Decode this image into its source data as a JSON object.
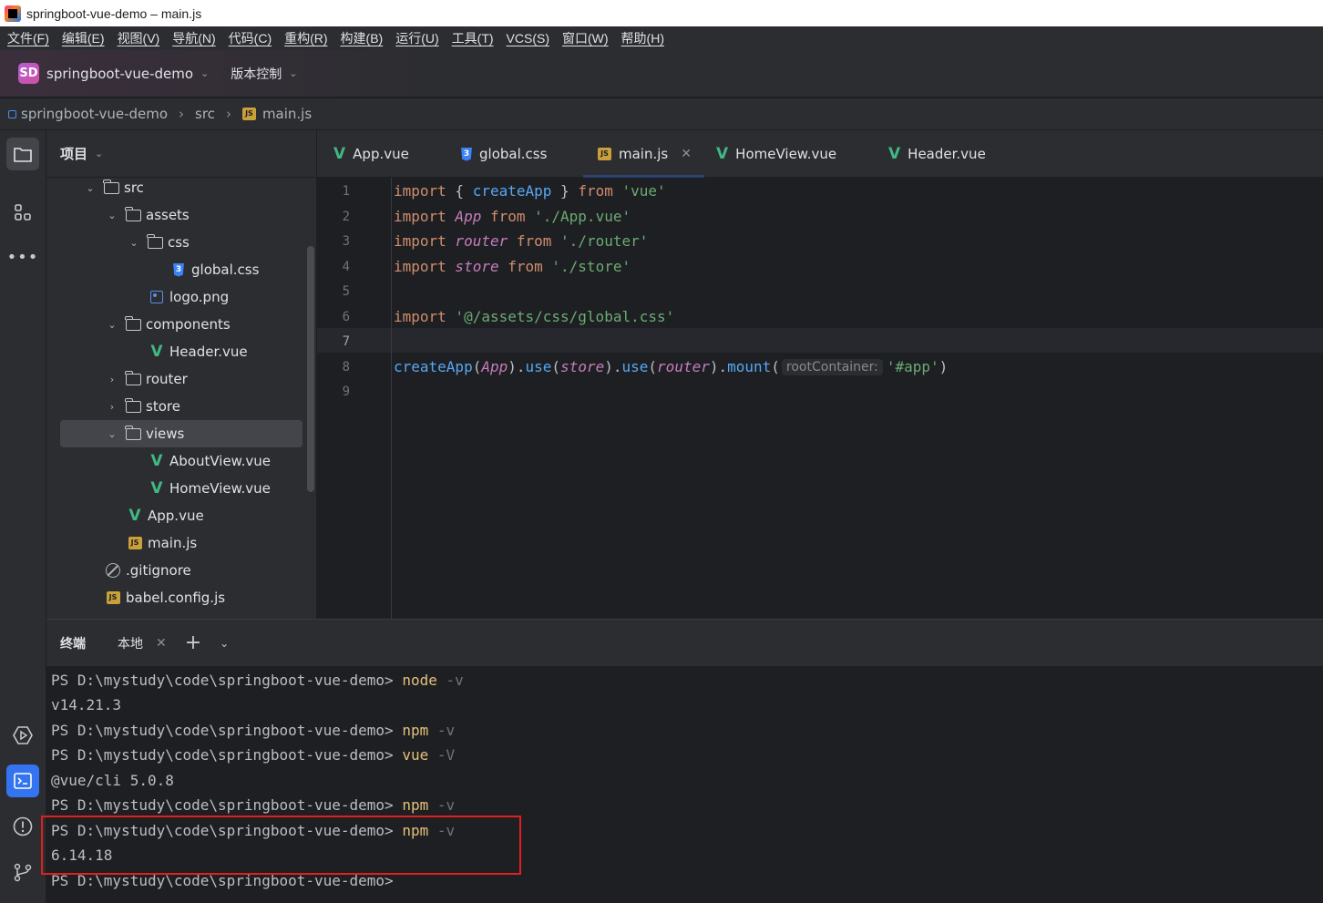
{
  "window": {
    "title": "springboot-vue-demo – main.js"
  },
  "menu": [
    "文件(F)",
    "编辑(E)",
    "视图(V)",
    "导航(N)",
    "代码(C)",
    "重构(R)",
    "构建(B)",
    "运行(U)",
    "工具(T)",
    "VCS(S)",
    "窗口(W)",
    "帮助(H)"
  ],
  "toolbar": {
    "project_badge": "SD",
    "project_name": "springboot-vue-demo",
    "vcs_label": "版本控制"
  },
  "breadcrumb": {
    "project": "springboot-vue-demo",
    "folder": "src",
    "file": "main.js",
    "js_badge": "JS"
  },
  "project_panel": {
    "title": "项目",
    "tree": [
      {
        "label": "src",
        "kind": "folder",
        "expanded": true,
        "depth": 0
      },
      {
        "label": "assets",
        "kind": "folder",
        "expanded": true,
        "depth": 1
      },
      {
        "label": "css",
        "kind": "folder",
        "expanded": true,
        "depth": 2
      },
      {
        "label": "global.css",
        "kind": "css",
        "depth": 3
      },
      {
        "label": "logo.png",
        "kind": "image",
        "depth": 2
      },
      {
        "label": "components",
        "kind": "folder",
        "expanded": true,
        "depth": 1
      },
      {
        "label": "Header.vue",
        "kind": "vue",
        "depth": 2
      },
      {
        "label": "router",
        "kind": "folder",
        "expanded": false,
        "depth": 1
      },
      {
        "label": "store",
        "kind": "folder",
        "expanded": false,
        "depth": 1
      },
      {
        "label": "views",
        "kind": "folder",
        "expanded": true,
        "depth": 1,
        "selected": true
      },
      {
        "label": "AboutView.vue",
        "kind": "vue",
        "depth": 2
      },
      {
        "label": "HomeView.vue",
        "kind": "vue",
        "depth": 2
      },
      {
        "label": "App.vue",
        "kind": "vue",
        "depth": 1
      },
      {
        "label": "main.js",
        "kind": "js",
        "depth": 1
      },
      {
        "label": ".gitignore",
        "kind": "ignore",
        "depth": 0
      },
      {
        "label": "babel.config.js",
        "kind": "js",
        "depth": 0
      }
    ]
  },
  "editor": {
    "tabs": [
      {
        "label": "App.vue",
        "kind": "vue"
      },
      {
        "label": "global.css",
        "kind": "css"
      },
      {
        "label": "main.js",
        "kind": "js",
        "active": true
      },
      {
        "label": "HomeView.vue",
        "kind": "vue"
      },
      {
        "label": "Header.vue",
        "kind": "vue"
      }
    ],
    "line_numbers": [
      "1",
      "2",
      "3",
      "4",
      "5",
      "6",
      "7",
      "8",
      "9"
    ],
    "current_line": 7,
    "code": {
      "l1": {
        "kw": "import",
        "p1": " { ",
        "fn": "createApp",
        "p2": " } ",
        "kw2": "from",
        "str": " 'vue'"
      },
      "l2": {
        "kw": "import",
        "id": " App",
        "kw2": " from",
        "str": " './App.vue'"
      },
      "l3": {
        "kw": "import",
        "id": " router",
        "kw2": " from",
        "str": " './router'"
      },
      "l4": {
        "kw": "import",
        "id": " store",
        "kw2": " from",
        "str": " './store'"
      },
      "l6": {
        "kw": "import",
        "str": " '@/assets/css/global.css'"
      },
      "l8": {
        "fn1": "createApp",
        "p1": "(",
        "id1": "App",
        "p2": ").",
        "fn2": "use",
        "p3": "(",
        "id2": "store",
        "p4": ").",
        "fn3": "use",
        "p5": "(",
        "id3": "router",
        "p6": ").",
        "fn4": "mount",
        "p7": "(",
        "hint": "rootContainer:",
        "str": "'#app'",
        "p8": ")"
      }
    }
  },
  "terminal": {
    "title": "终端",
    "tab_label": "本地",
    "prompt": "PS D:\\mystudy\\code\\springboot-vue-demo>",
    "lines": [
      {
        "cmd": "node",
        "flag": "-v"
      },
      {
        "output": "v14.21.3"
      },
      {
        "cmd": "npm",
        "flag": "-v"
      },
      {
        "cmd": "vue",
        "flag": "-V"
      },
      {
        "output": "@vue/cli 5.0.8"
      },
      {
        "cmd": "npm",
        "flag": "-v"
      },
      {
        "cmd": "npm",
        "flag": "-v"
      },
      {
        "output": "6.14.18"
      },
      {
        "cmd": "",
        "flag": ""
      }
    ]
  },
  "colors": {
    "accent": "#3574f0",
    "highlight_box": "#e02020",
    "vue_green": "#41b883"
  }
}
